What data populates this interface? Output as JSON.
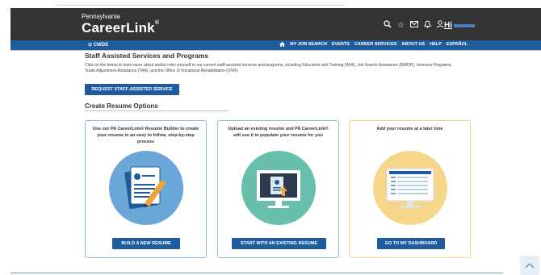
{
  "header": {
    "logo_top": "Pennsylvania",
    "logo_main": "CareerLink",
    "logo_reg": "®",
    "icons": [
      "search-icon",
      "star-icon",
      "mail-icon",
      "bell-icon",
      "user-icon"
    ],
    "user_greeting": "Hi"
  },
  "nav": {
    "cwds": "CWDS",
    "items": [
      "MY JOB SEARCH",
      "EVENTS",
      "CAREER SERVICES",
      "ABOUT US",
      "HELP",
      "ESPAÑOL"
    ]
  },
  "staff": {
    "title": "Staff Assisted Services and Programs",
    "description": "Click on the below to learn more about and/or refer yourself to our current staff-assisted services and programs, including Education and Training (WIA), Job Search Assistance (BWDP), Veterans Programs, Trade Adjustment Assistance (TAA), and the Office of Vocational Rehabilitation (OVR).",
    "button": "REQUEST STAFF-ASSISTED SERVICE"
  },
  "resume": {
    "title": "Create Resume Options",
    "cards": [
      {
        "text": "Use our PA CareerLink® Resume Builder to create your resume in an easy to follow, step-by-step process",
        "button": "BUILD A NEW RESUME",
        "icon": "resume-document-icon"
      },
      {
        "text": "Upload an existing resume and PA CareerLink® will use it to populate your resume for you",
        "button": "START WITH AN EXISTING RESUME",
        "icon": "upload-monitor-icon"
      },
      {
        "text": "Add your resume at a later time",
        "button": "GO TO MY DASHBOARD",
        "icon": "dashboard-monitor-icon"
      }
    ]
  },
  "colors": {
    "header_bg": "#333333",
    "nav_bg": "#1f5c9e",
    "button_bg": "#1f5c9e",
    "card1_accent": "#6aa7d8",
    "card2_accent": "#68bfac",
    "card3_accent": "#f6d68a"
  },
  "scroll_top_icon": "chevron-up-icon"
}
